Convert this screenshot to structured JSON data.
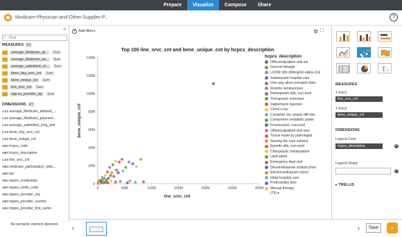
{
  "nav": {
    "tabs": [
      {
        "label": "Prepare",
        "active": false
      },
      {
        "label": "Visualize",
        "active": true
      },
      {
        "label": "Compose",
        "active": false
      },
      {
        "label": "Share",
        "active": false
      }
    ]
  },
  "titlebar": {
    "title": "Medicare-Physician-and-Other-Supplier-P...",
    "help_icon": "?"
  },
  "left_panel": {
    "collapse_icon": "«",
    "find_placeholder": "Find",
    "measures_label": "MEASURES",
    "measures_count": "10",
    "measures": [
      {
        "name": "average_Medicare_all...",
        "agg": "Sum"
      },
      {
        "name": "average_Medicare_pa...",
        "agg": "Sum"
      },
      {
        "name": "average_submitted_ch...",
        "agg": "Sum"
      },
      {
        "name": "bene_day_srvc_cnt",
        "agg": "Sum"
      },
      {
        "name": "bene_unique_cnt",
        "agg": "Sum"
      },
      {
        "name": "line_srvc_cnt",
        "agg": "Sum"
      },
      {
        "name": "npp es_provider_zip",
        "agg": "Sum"
      }
    ],
    "dimensions_label": "DIMENSIONS",
    "dimensions_count": "27",
    "dimensions": [
      {
        "type": "1.03",
        "name": "average_Medicare_allowed_..."
      },
      {
        "type": "1.03",
        "name": "average_Medicare_payment..."
      },
      {
        "type": "1.03",
        "name": "average_submitted_chrg_amt"
      },
      {
        "type": "1.03",
        "name": "bene_day_srvc_cnt"
      },
      {
        "type": "1.03",
        "name": "bene_unique_cnt"
      },
      {
        "type": "ABC",
        "name": "hcpcs_code"
      },
      {
        "type": "ABC",
        "name": "hcpcs_description"
      },
      {
        "type": "1.03",
        "name": "line_srvc_cnt"
      },
      {
        "type": "ABC",
        "name": "medicare_participation_indic..."
      },
      {
        "type": "ABC",
        "name": "npi"
      },
      {
        "type": "ABC",
        "name": "nppes_credentials"
      },
      {
        "type": "ABC",
        "name": "nppes_entity_code"
      },
      {
        "type": "ABC",
        "name": "nppes_provider_city"
      },
      {
        "type": "ABC",
        "name": "nppes_provider_country"
      },
      {
        "type": "ABC",
        "name": "nppes_provider_first_name"
      }
    ],
    "no_semantic": "No semantic element detected."
  },
  "toolbar": {
    "add_filters": "Add filters",
    "gear_icon": "⚙",
    "expand_icon": "⛶"
  },
  "chart_data": {
    "type": "scatter",
    "title": "Top 100 line_srvc_cnt and bene_unique_cnt by hcpcs_description",
    "xlabel": "line_srvc_cnt",
    "ylabel": "bene_unique_cnt",
    "x_ticks": [
      "0",
      "50M",
      "100M",
      "150M",
      "200M",
      "250M",
      "300M"
    ],
    "y_ticks": [
      "0",
      "20M",
      "40M",
      "60M",
      "80M",
      "100M",
      "120M",
      "140M"
    ],
    "xlim": [
      0,
      300000000
    ],
    "ylim": [
      0,
      140000000
    ],
    "legend_title": "hcpcs_description",
    "legend": [
      {
        "name": "Office/outpatient visit est",
        "color": "#4e79a7"
      },
      {
        "name": "Ground mileage",
        "color": "#59a14f"
      },
      {
        "name": "LOOM 300-399mg/ml iodine,1ml",
        "color": "#b07aa1"
      },
      {
        "name": "Subsequent hospital care",
        "color": "#4e79a7"
      },
      {
        "name": "One-way allow prorated miles",
        "color": "#9c755f"
      },
      {
        "name": "Routine venipuncture",
        "color": "#b07aa1"
      },
      {
        "name": "Darbepoetin alfa, non-esrd",
        "color": "#9c755f"
      },
      {
        "name": "Therapeutic exercises",
        "color": "#59a14f"
      },
      {
        "name": "Daptomycin injection",
        "color": "#e15759"
      },
      {
        "name": "Chest x-ray",
        "color": "#edc948"
      },
      {
        "name": "Complete cbc w/auto diff wbc",
        "color": "#76b7b2"
      },
      {
        "name": "Comprehen metabolic panel",
        "color": "#59a14f"
      },
      {
        "name": "Ferumoxytol, non-esrd",
        "color": "#4e79a7"
      },
      {
        "name": "Office/outpatient visit new",
        "color": "#b07aa1"
      },
      {
        "name": "Tissue exam by pathologist",
        "color": "#e15759"
      },
      {
        "name": "Nursing fac care subseq",
        "color": "#f28e2b"
      },
      {
        "name": "Epoetin alfa, non-esrd",
        "color": "#e15759"
      },
      {
        "name": "Chiropractic manipulation",
        "color": "#edc948"
      },
      {
        "name": "Lipid panel",
        "color": "#59a14f"
      },
      {
        "name": "Emergency dept visit",
        "color": "#e15759"
      },
      {
        "name": "Dexamethasone sodium phos",
        "color": "#4e79a7"
      },
      {
        "name": "Electrocardiogram report",
        "color": "#f28e2b"
      },
      {
        "name": "Initial hospital care",
        "color": "#76b7b2"
      },
      {
        "name": "Prothrombin time",
        "color": "#4e79a7"
      },
      {
        "name": "Manual therapy",
        "color": "#edc948"
      }
    ],
    "legend_more": "(76) ▾",
    "points": [
      {
        "x": 215000000,
        "y": 111000000,
        "c": "#4e79a7"
      },
      {
        "x": 80000000,
        "y": 27000000,
        "c": "#f28e2b"
      },
      {
        "x": 72000000,
        "y": 19000000,
        "c": "#edc948"
      },
      {
        "x": 65000000,
        "y": 22000000,
        "c": "#4e79a7"
      },
      {
        "x": 58000000,
        "y": 24000000,
        "c": "#b07aa1"
      },
      {
        "x": 45000000,
        "y": 27000000,
        "c": "#9c755f"
      },
      {
        "x": 52000000,
        "y": 18000000,
        "c": "#59a14f"
      },
      {
        "x": 40000000,
        "y": 24000000,
        "c": "#e15759"
      },
      {
        "x": 33000000,
        "y": 25000000,
        "c": "#edc948"
      },
      {
        "x": 28000000,
        "y": 21000000,
        "c": "#59a14f"
      },
      {
        "x": 22000000,
        "y": 18000000,
        "c": "#b07aa1"
      },
      {
        "x": 35000000,
        "y": 15000000,
        "c": "#e15759"
      },
      {
        "x": 47000000,
        "y": 14000000,
        "c": "#76b7b2"
      },
      {
        "x": 38000000,
        "y": 12000000,
        "c": "#4e79a7"
      },
      {
        "x": 26000000,
        "y": 12000000,
        "c": "#f28e2b"
      },
      {
        "x": 18000000,
        "y": 13000000,
        "c": "#e15759"
      },
      {
        "x": 24000000,
        "y": 9000000,
        "c": "#59a14f"
      },
      {
        "x": 14000000,
        "y": 9000000,
        "c": "#edc948"
      },
      {
        "x": 30000000,
        "y": 8000000,
        "c": "#9c755f"
      },
      {
        "x": 20000000,
        "y": 6000000,
        "c": "#4e79a7"
      },
      {
        "x": 12000000,
        "y": 6000000,
        "c": "#b07aa1"
      },
      {
        "x": 8000000,
        "y": 7000000,
        "c": "#76b7b2"
      },
      {
        "x": 16000000,
        "y": 4000000,
        "c": "#e15759"
      },
      {
        "x": 9000000,
        "y": 4000000,
        "c": "#59a14f"
      },
      {
        "x": 6000000,
        "y": 3000000,
        "c": "#f28e2b"
      },
      {
        "x": 4000000,
        "y": 3500000,
        "c": "#4e79a7"
      },
      {
        "x": 3000000,
        "y": 2000000,
        "c": "#b07aa1"
      },
      {
        "x": 11000000,
        "y": 2500000,
        "c": "#edc948"
      },
      {
        "x": 7000000,
        "y": 1500000,
        "c": "#e15759"
      },
      {
        "x": 5000000,
        "y": 1000000,
        "c": "#59a14f"
      },
      {
        "x": 2000000,
        "y": 1500000,
        "c": "#76b7b2"
      },
      {
        "x": 2500000,
        "y": 800000,
        "c": "#4e79a7"
      },
      {
        "x": 1500000,
        "y": 1200000,
        "c": "#f28e2b"
      },
      {
        "x": 1000000,
        "y": 600000,
        "c": "#9c755f"
      },
      {
        "x": 800000,
        "y": 400000,
        "c": "#b07aa1"
      },
      {
        "x": 4500000,
        "y": 500000,
        "c": "#e15759"
      },
      {
        "x": 3500000,
        "y": 700000,
        "c": "#edc948"
      },
      {
        "x": 13000000,
        "y": 1200000,
        "c": "#4e79a7"
      },
      {
        "x": 17000000,
        "y": 2000000,
        "c": "#59a14f"
      },
      {
        "x": 60000000,
        "y": 3000000,
        "c": "#f28e2b"
      },
      {
        "x": 70000000,
        "y": 1500000,
        "c": "#76b7b2"
      },
      {
        "x": 85000000,
        "y": 2000000,
        "c": "#e15759"
      },
      {
        "x": 42000000,
        "y": 2500000,
        "c": "#b07aa1"
      },
      {
        "x": 55000000,
        "y": 1000000,
        "c": "#4e79a7"
      },
      {
        "x": 25000000,
        "y": 3000000,
        "c": "#edc948"
      },
      {
        "x": 33000000,
        "y": 1800000,
        "c": "#9c755f"
      },
      {
        "x": 19000000,
        "y": 800000,
        "c": "#e15759"
      },
      {
        "x": 10000000,
        "y": 900000,
        "c": "#59a14f"
      },
      {
        "x": 6500000,
        "y": 2200000,
        "c": "#4e79a7"
      },
      {
        "x": 1200000,
        "y": 2500000,
        "c": "#f28e2b"
      }
    ]
  },
  "right_panel": {
    "chart_types": [
      {
        "icon": "bar-chart-icon",
        "selected": false
      },
      {
        "icon": "grouped-bar-icon",
        "selected": false
      },
      {
        "icon": "horizontal-bar-icon",
        "selected": false
      },
      {
        "icon": "line-chart-icon",
        "selected": false
      },
      {
        "icon": "scatter-icon",
        "selected": true
      },
      {
        "icon": "map-icon",
        "selected": false
      },
      {
        "icon": "table-icon",
        "selected": false
      },
      {
        "icon": "pie-icon",
        "selected": false
      },
      {
        "icon": "text-icon",
        "selected": false
      }
    ],
    "measures_label": "MEASURES",
    "y_axis1_label": "Y Axis1",
    "y_axis1_value": "line_srvc_cnt",
    "y_axis2_label": "Y Axis2",
    "y_axis2_value": "bene_unique_cnt",
    "dimensions_label": "DIMENSIONS",
    "legend_color_label": "Legend Color",
    "legend_color_value": "hcpcs_description",
    "legend_shape_label": "Legend Shape",
    "trellis_label": "TRELLIS"
  },
  "bottom": {
    "prev_icon": "‹",
    "next_icon": "›",
    "save_label": "Save",
    "add_icon": "+"
  }
}
